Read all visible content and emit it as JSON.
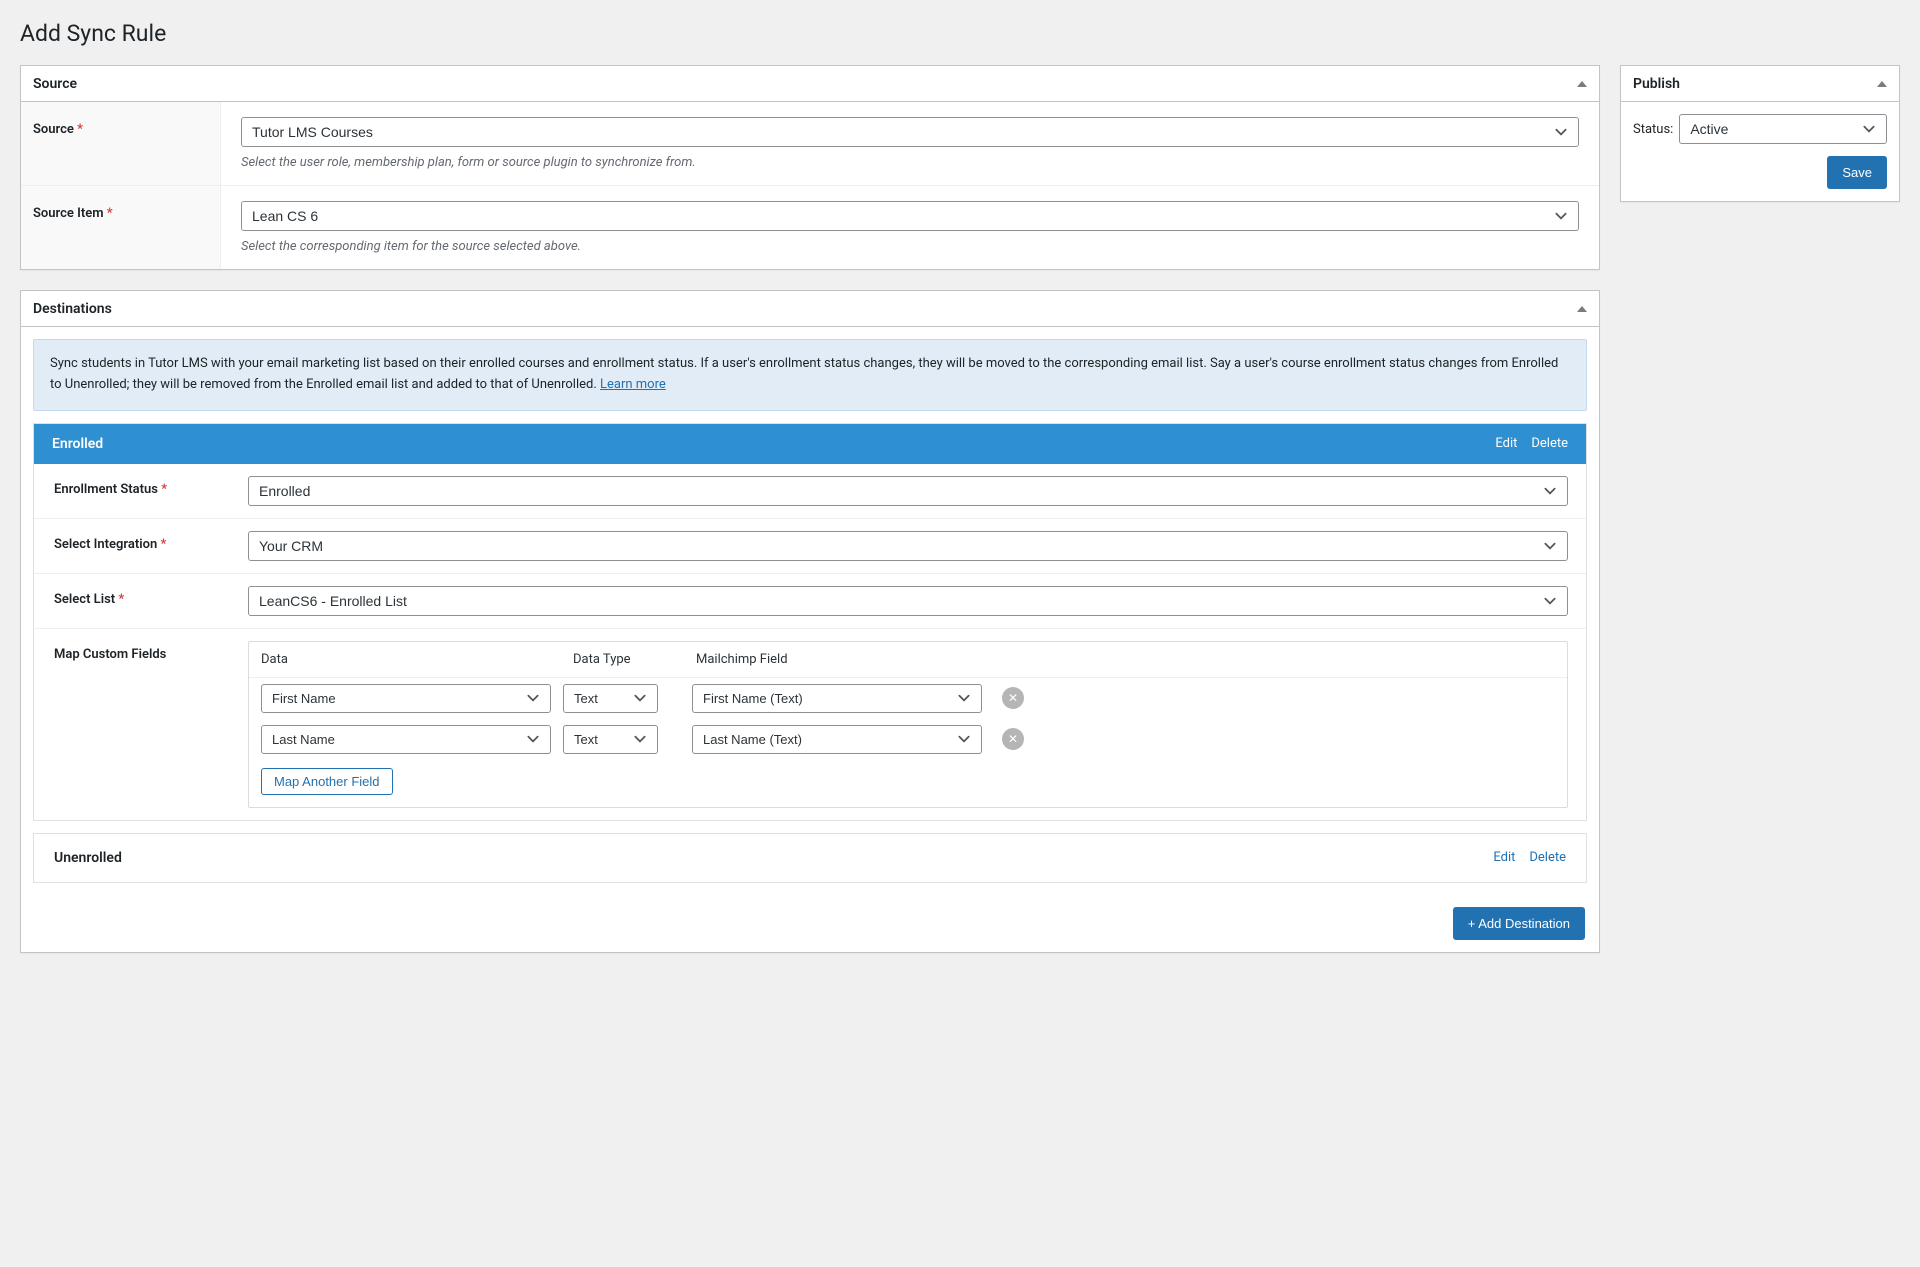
{
  "page": {
    "title": "Add Sync Rule"
  },
  "source_panel": {
    "title": "Source",
    "source": {
      "label": "Source",
      "value": "Tutor LMS Courses",
      "help": "Select the user role, membership plan, form or source plugin to synchronize from."
    },
    "source_item": {
      "label": "Source Item",
      "value": "Lean CS 6",
      "help": "Select the corresponding item for the source selected above."
    }
  },
  "destinations_panel": {
    "title": "Destinations",
    "info_text": "Sync students in Tutor LMS with your email marketing list based on their enrolled courses and enrollment status. If a user's enrollment status changes, they will be moved to the corresponding email list. Say a user's course enrollment status changes from Enrolled to Unenrolled; they will be removed from the Enrolled email list and added to that of Unenrolled. ",
    "learn_more": "Learn more",
    "enrolled": {
      "title": "Enrolled",
      "edit": "Edit",
      "delete": "Delete",
      "enrollment_status": {
        "label": "Enrollment Status",
        "value": "Enrolled"
      },
      "integration": {
        "label": "Select Integration",
        "value": "Your CRM"
      },
      "list": {
        "label": "Select List",
        "value": "LeanCS6 - Enrolled List"
      },
      "map": {
        "label": "Map Custom Fields",
        "head_data": "Data",
        "head_type": "Data Type",
        "head_field": "Mailchimp Field",
        "rows": [
          {
            "data": "First Name",
            "type": "Text",
            "field": "First Name (Text)"
          },
          {
            "data": "Last Name",
            "type": "Text",
            "field": "Last Name (Text)"
          }
        ],
        "add_btn": "Map Another Field"
      }
    },
    "unenrolled": {
      "title": "Unenrolled",
      "edit": "Edit",
      "delete": "Delete"
    },
    "add_btn": "+ Add Destination"
  },
  "publish_panel": {
    "title": "Publish",
    "status_label": "Status:",
    "status_value": "Active",
    "save": "Save"
  }
}
